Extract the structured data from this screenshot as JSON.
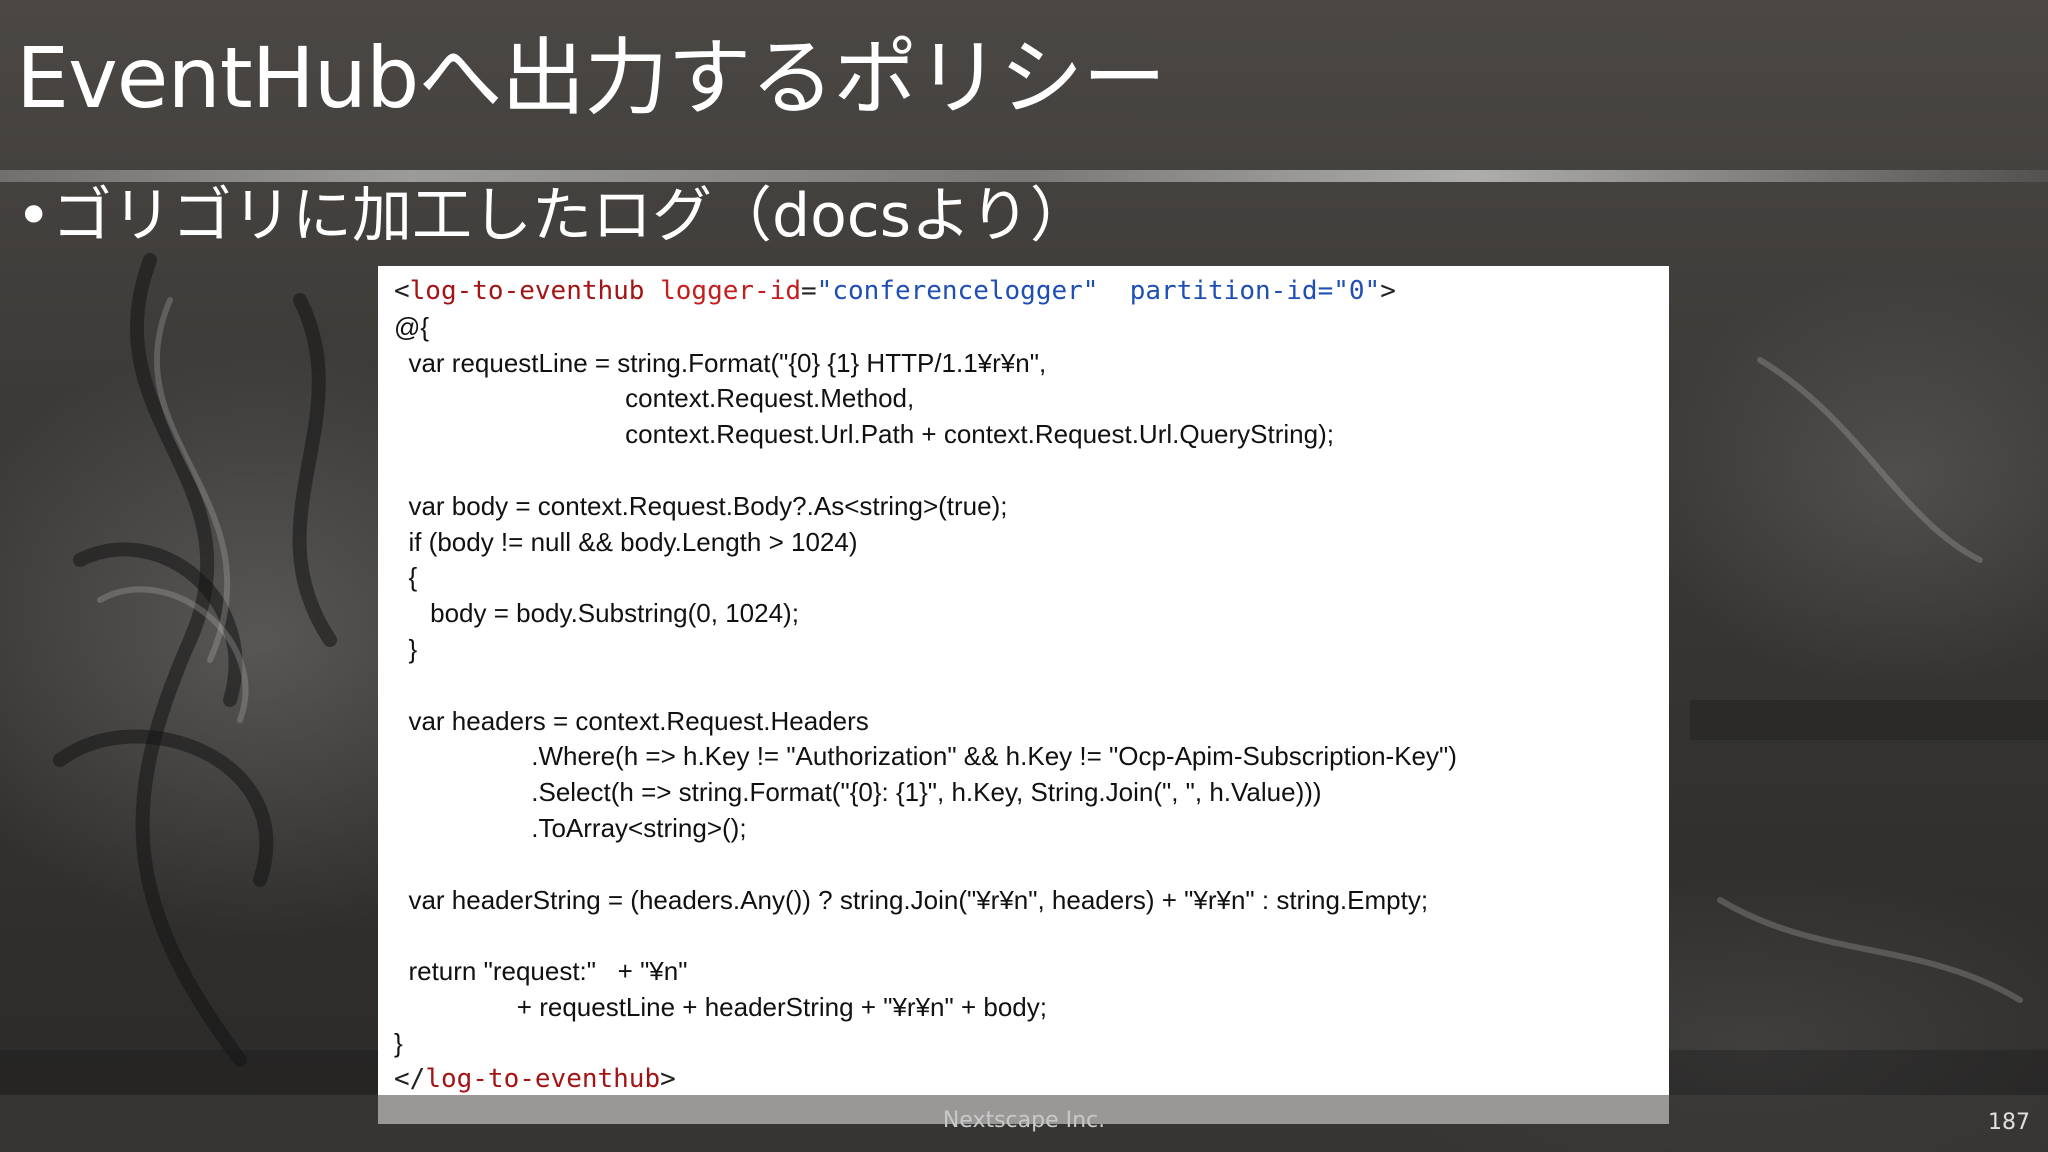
{
  "slide": {
    "title": "EventHubへ出力するポリシー",
    "bullet": "ゴリゴリに加工したログ（docsより）",
    "bullet_marker": "•",
    "footer_text": "Nextscape Inc.",
    "slide_number": "187"
  },
  "code": {
    "open_tag": {
      "lt": "<",
      "element": "log-to-eventhub",
      "attr1_name": "logger-id",
      "attr1_eq": "=",
      "attr1_value": "\"conferencelogger\"",
      "attr2_name": "partition-id",
      "attr2_eq": "=",
      "attr2_value": "\"0\"",
      "gt": ">"
    },
    "lines": [
      "@{",
      "  var requestLine = string.Format(\"{0} {1} HTTP/1.1¥r¥n\",",
      "                                context.Request.Method,",
      "                                context.Request.Url.Path + context.Request.Url.QueryString);",
      "",
      "  var body = context.Request.Body?.As<string>(true);",
      "  if (body != null && body.Length > 1024)",
      "  {",
      "     body = body.Substring(0, 1024);",
      "  }",
      "",
      "  var headers = context.Request.Headers",
      "                   .Where(h => h.Key != \"Authorization\" && h.Key != \"Ocp-Apim-Subscription-Key\")",
      "                   .Select(h => string.Format(\"{0}: {1}\", h.Key, String.Join(\", \", h.Value)))",
      "                   .ToArray<string>();",
      "",
      "  var headerString = (headers.Any()) ? string.Join(\"¥r¥n\", headers) + \"¥r¥n\" : string.Empty;",
      "",
      "  return \"request:\"   + \"¥n\"",
      "                 + requestLine + headerString + \"¥r¥n\" + body;",
      "}"
    ],
    "close_tag": {
      "lt": "</",
      "element": "log-to-eventhub",
      "gt": ">"
    }
  },
  "colors": {
    "code_element": "#a31515",
    "code_attribute": "#c41e1e",
    "code_value": "#1f4fb5",
    "title_text": "#ffffff"
  }
}
